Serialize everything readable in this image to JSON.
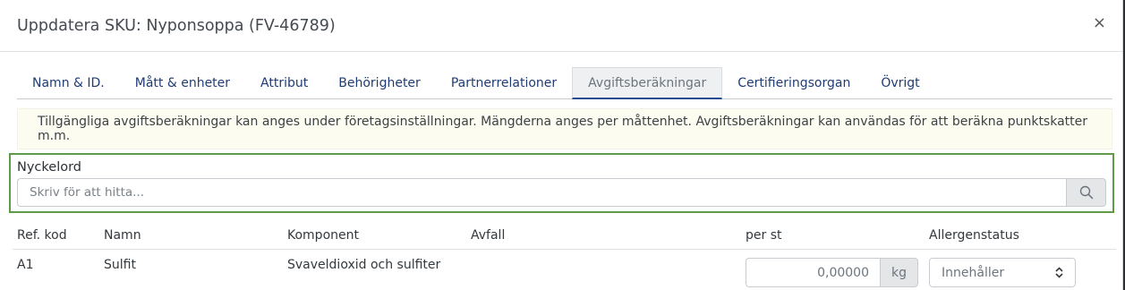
{
  "header": {
    "title": "Uppdatera SKU: Nyponsoppa (FV-46789)",
    "close_glyph": "×"
  },
  "tabs": [
    {
      "label": "Namn & ID.",
      "active": false
    },
    {
      "label": "Mått & enheter",
      "active": false
    },
    {
      "label": "Attribut",
      "active": false
    },
    {
      "label": "Behörigheter",
      "active": false
    },
    {
      "label": "Partnerrelationer",
      "active": false
    },
    {
      "label": "Avgiftsberäkningar",
      "active": true
    },
    {
      "label": "Certifieringsorgan",
      "active": false
    },
    {
      "label": "Övrigt",
      "active": false
    }
  ],
  "info_text": "Tillgängliga avgiftsberäkningar kan anges under företagsinställningar. Mängderna anges per måttenhet. Avgiftsberäkningar kan användas för att beräkna punktskatter m.m.",
  "search": {
    "label": "Nyckelord",
    "placeholder": "Skriv för att hitta...",
    "value": "",
    "icon": "search-icon"
  },
  "table": {
    "headers": [
      "Ref. kod",
      "Namn",
      "Komponent",
      "Avfall",
      "per st",
      "Allergenstatus"
    ],
    "rows": [
      {
        "ref": "A1",
        "name": "Sulfit",
        "component": "Svaveldioxid och sulfiter",
        "waste": "",
        "quantity": "0,00000",
        "unit": "kg",
        "allergen_status": "Innehåller"
      }
    ]
  },
  "colors": {
    "accent": "#234b8f",
    "highlight_border": "#5e9a48",
    "info_bg": "#fcfcf1"
  }
}
